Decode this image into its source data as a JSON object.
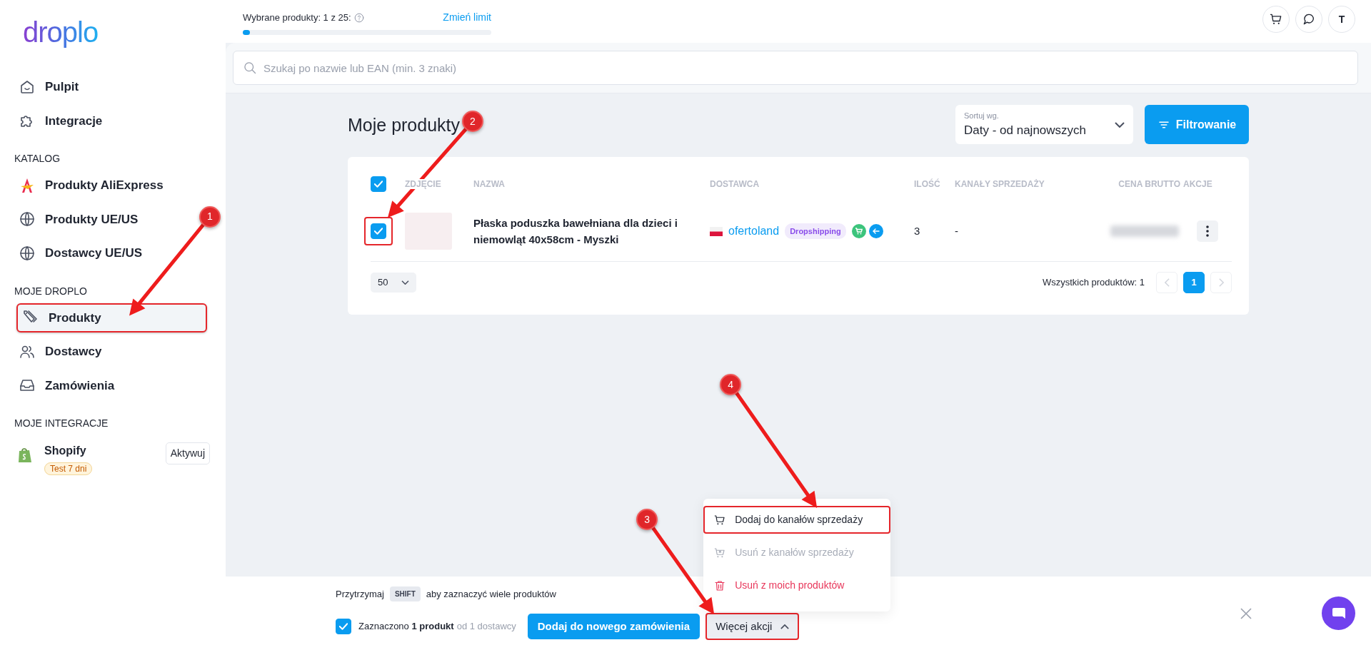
{
  "sidebar": {
    "logo": "droplo",
    "items": [
      {
        "label": "Pulpit",
        "selected": false,
        "highlighted": false
      },
      {
        "label": "Integracje",
        "selected": false,
        "highlighted": false
      }
    ],
    "sections": [
      {
        "title": "KATALOG",
        "items": [
          {
            "label": "Produkty AliExpress",
            "selected": false,
            "highlighted": false
          },
          {
            "label": "Produkty UE/US",
            "selected": false,
            "highlighted": false
          },
          {
            "label": "Dostawcy UE/US",
            "selected": false,
            "highlighted": false
          }
        ]
      },
      {
        "title": "MOJE DROPLO",
        "items": [
          {
            "label": "Produkty",
            "selected": true,
            "highlighted": true
          },
          {
            "label": "Dostawcy",
            "selected": false,
            "highlighted": false
          },
          {
            "label": "Zamówienia",
            "selected": false,
            "highlighted": false
          }
        ]
      }
    ],
    "integrations": {
      "title": "MOJE INTEGRACJE",
      "items": [
        {
          "name": "Shopify",
          "badge": "Test 7 dni",
          "button": "Aktywuj"
        }
      ]
    }
  },
  "header": {
    "limit": {
      "label": "Wybrane produkty: 1 z 25:",
      "link": "Zmień limit",
      "level": 0.03
    },
    "avatar": "T"
  },
  "search": {
    "placeholder": "Szukaj po nazwie lub EAN (min. 3 znaki)"
  },
  "page": {
    "title": "Moje produkty",
    "sort": {
      "label": "Sortuj wg.",
      "value": "Daty - od najnowszych"
    },
    "filter_button": "Filtrowanie"
  },
  "table": {
    "select_all_checked": true,
    "columns": [
      "ZDJĘCIE",
      "NAZWA",
      "DOSTAWCA",
      "ILOŚĆ",
      "KANAŁY SPRZEDAŻY",
      "CENA BRUTTO",
      "AKCJE"
    ],
    "rows": [
      {
        "checked": true,
        "highlighted": true,
        "name": "Płaska poduszka bawełniana dla dzieci i niemowląt 40x58cm - Myszki",
        "supplier": "ofertoland",
        "supplier_tag": "Dropshipping",
        "quantity": "3",
        "channels": "-"
      }
    ],
    "page_size": "50",
    "total": "Wszystkich produktów: 1",
    "prev_disabled": true,
    "next_disabled": true,
    "pages": [
      {
        "label": "1",
        "selected": true
      }
    ]
  },
  "bottom_bar": {
    "hint_before": "Przytrzymaj",
    "hint_key": "SHIFT",
    "hint_after": "aby zaznaczyć wiele produktów",
    "all_checked": true,
    "selection": "Zaznaczono **1 produkt**",
    "selection_suffix": "od 1 dostawcy",
    "primary_button": "Dodaj do nowego zamówienia",
    "more_button": {
      "label": "Więcej akcji",
      "expanded": true,
      "highlighted": true
    },
    "menu": [
      {
        "label": "Dodaj do kanałów sprzedaży",
        "kind": "cart",
        "disabled": false,
        "danger": false,
        "highlighted": true
      },
      {
        "label": "Usuń z kanałów sprzedaży",
        "kind": "cart-remove",
        "disabled": true,
        "danger": false,
        "highlighted": false
      },
      {
        "label": "Usuń z moich produktów",
        "kind": "trash",
        "disabled": false,
        "danger": true,
        "highlighted": false
      }
    ]
  },
  "annotations": [
    {
      "number": "1"
    },
    {
      "number": "2"
    },
    {
      "number": "3"
    },
    {
      "number": "4"
    }
  ]
}
